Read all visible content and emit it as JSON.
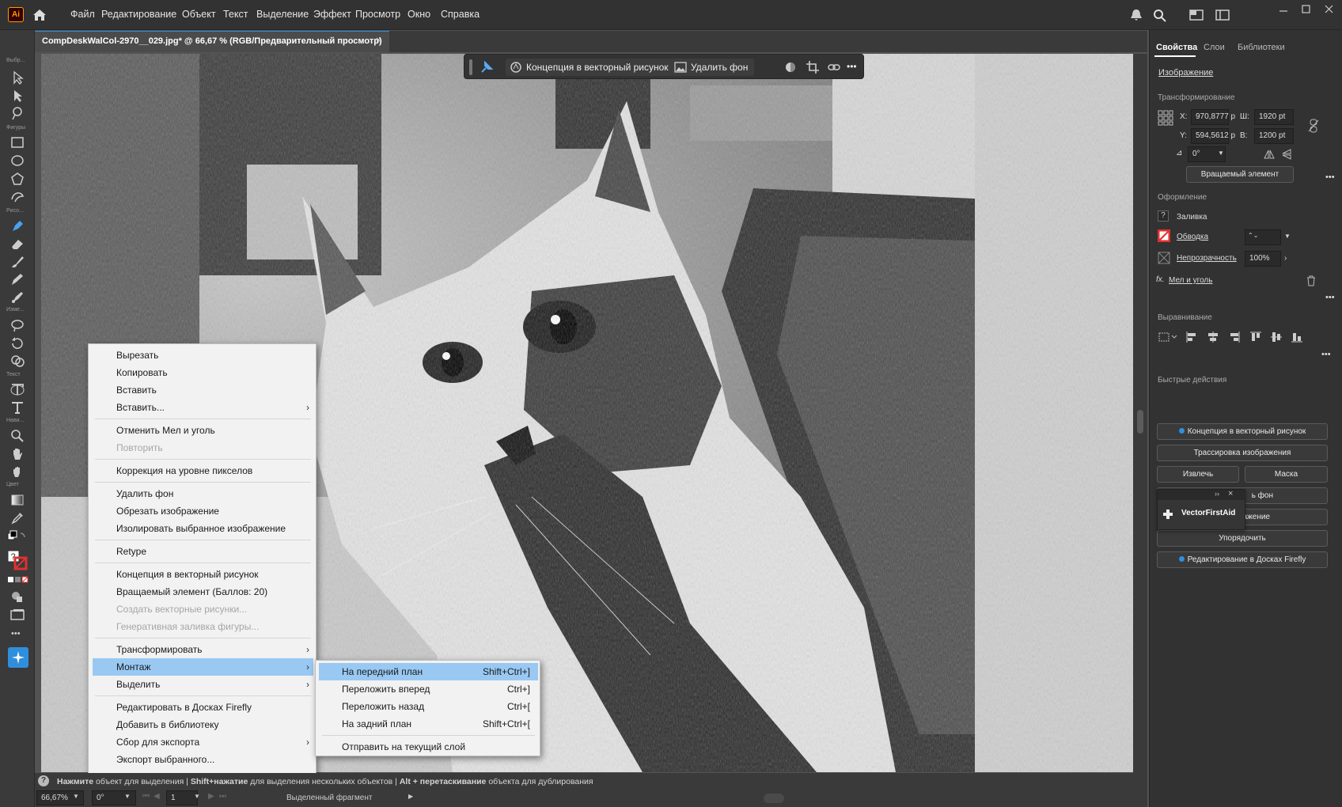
{
  "app": {
    "logo": "Ai"
  },
  "menu": [
    "Файл",
    "Редактирование",
    "Объект",
    "Текст",
    "Выделение",
    "Эффект",
    "Просмотр",
    "Окно",
    "Справка"
  ],
  "document": {
    "tab_title": "CompDeskWalCol-2970__029.jpg* @ 66,67 % (RGB/Предварительный просмотр)",
    "close": "×"
  },
  "left_tools": {
    "groups": [
      "Выбр...",
      "Фигуры",
      "Рисо...",
      "Изме...",
      "Текст",
      "Нави...",
      "Цвет"
    ],
    "more": "•••"
  },
  "context_toolbar": {
    "vectorize": "Концепция в векторный рисунок",
    "remove_bg": "Удалить фон",
    "more": "•••"
  },
  "context_menu": {
    "items": [
      {
        "label": "Вырезать",
        "state": "normal"
      },
      {
        "label": "Копировать",
        "state": "normal"
      },
      {
        "label": "Вставить",
        "state": "normal"
      },
      {
        "label": "Вставить...",
        "state": "submenu"
      },
      {
        "label": "Отменить Мел и уголь",
        "state": "normal"
      },
      {
        "label": "Повторить",
        "state": "disabled"
      },
      {
        "label": "Коррекция на уровне пикселов",
        "state": "normal"
      },
      {
        "label": "Удалить фон",
        "state": "normal"
      },
      {
        "label": "Обрезать изображение",
        "state": "normal"
      },
      {
        "label": "Изолировать выбранное изображение",
        "state": "normal"
      },
      {
        "label": "Retype",
        "state": "normal"
      },
      {
        "label": "Концепция в векторный рисунок",
        "state": "normal"
      },
      {
        "label": "Вращаемый элемент (Баллов: 20)",
        "state": "normal"
      },
      {
        "label": "Создать векторные рисунки...",
        "state": "disabled"
      },
      {
        "label": "Генеративная заливка фигуры...",
        "state": "disabled"
      },
      {
        "label": "Трансформировать",
        "state": "submenu"
      },
      {
        "label": "Монтаж",
        "state": "highlighted"
      },
      {
        "label": "Выделить",
        "state": "submenu"
      },
      {
        "label": "Редактировать в Досках Firefly",
        "state": "normal"
      },
      {
        "label": "Добавить в библиотеку",
        "state": "normal"
      },
      {
        "label": "Сбор для экспорта",
        "state": "submenu"
      },
      {
        "label": "Экспорт выбранного...",
        "state": "normal"
      }
    ]
  },
  "submenu": {
    "items": [
      {
        "label": "На передний план",
        "shortcut": "Shift+Ctrl+]"
      },
      {
        "label": "Переложить вперед",
        "shortcut": "Ctrl+]"
      },
      {
        "label": "Переложить назад",
        "shortcut": "Ctrl+["
      },
      {
        "label": "На задний план",
        "shortcut": "Shift+Ctrl+["
      },
      {
        "label": "Отправить на текущий слой",
        "shortcut": ""
      }
    ]
  },
  "status": {
    "p1": "Нажмите",
    "p2": "объект для выделения",
    "p3": "Shift+нажатие",
    "p4": "для выделения нескольких объектов",
    "p5": "Alt + перетаскивание",
    "p6": "объекта для дублирования"
  },
  "bottom": {
    "zoom": "66,67%",
    "angle": "0°",
    "artboard": "1",
    "selection": "Выделенный фрагмент"
  },
  "right_panel": {
    "tabs": [
      "Свойства",
      "Слои",
      "Библиотеки"
    ],
    "object_type": "Изображение",
    "transform": {
      "title": "Трансформирование",
      "x_label": "X:",
      "x": "970,8777 p",
      "y_label": "Y:",
      "y": "594,5612 p",
      "w_label": "Ш:",
      "w": "1920 pt",
      "h_label": "В:",
      "h": "1200 pt",
      "angle": "0°",
      "rotate_btn": "Вращаемый элемент"
    },
    "appearance": {
      "title": "Оформление",
      "fill": "Заливка",
      "stroke": "Обводка",
      "opacity_label": "Непрозрачность",
      "opacity": "100%",
      "effect": "Мел и уголь",
      "fx": "fx."
    },
    "align": {
      "title": "Выравнивание"
    },
    "quick": {
      "title": "Быстрые действия",
      "b1": "Концепция в векторный рисунок",
      "b2": "Трассировка изображения",
      "b3": "Извлечь",
      "b4": "Маска",
      "b5": "ь фон",
      "b6": "бражение",
      "b7": "Упорядочить",
      "b8": "Редактирование в Досках Firefly"
    },
    "plugin": {
      "name": "VectorFirstAid",
      "arrows": "››",
      "close": "×"
    },
    "more": "•••"
  },
  "colors": {
    "highlight": "#99c9f3",
    "accent": "#2f8fdd",
    "stroke": "#e03030"
  }
}
